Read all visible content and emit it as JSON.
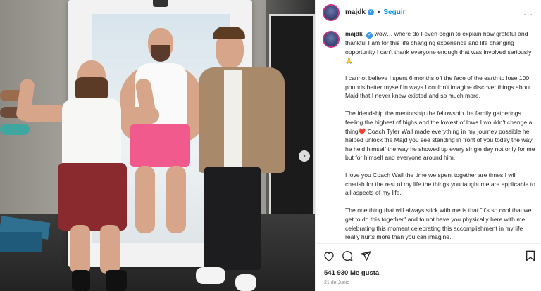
{
  "post": {
    "username": "majdk",
    "follow_label": "Seguir",
    "dot_separator": "•",
    "more_label": "...",
    "caption_username": "majdk",
    "caption_paragraphs": [
      "wow… where do I even begin to explain how grateful and thankful I am for this life changing experience and life changing opportunity I can't thank everyone enough that was involved seriously🙏",
      "I cannot believe I spent 6 months off the face of the earth to lose 100 pounds better myself in ways I couldn't imagine discover things about Majd that I never knew existed and so much more.",
      "The friendship the mentorship the fellowship the family gatherings feeling the highest of highs and the lowest of lows I wouldn't change a thing❤️ Coach Tyler Wall made everything in my journey possible he helped unlock the Majd you see standing in front of you today the way he held himself the way he showed up every single day not only for me but for himself and everyone around him.",
      "I love you Coach Wall the time we spent together are times I will cherish for the rest of my life the things you taught me are applicable to all aspects of my life.",
      "The one thing that will always stick with me is that \"it's so cool that we get to do this together\" and to not have you physically here with me celebrating this moment celebrating this accomplishment in my life really hurts more than you can imagine."
    ],
    "likes": "541 930 Me gusta",
    "date": "21 de Junio"
  },
  "icons": {
    "like": "heart-icon",
    "comment": "comment-icon",
    "share": "send-icon",
    "save": "bookmark-icon",
    "next": "chevron-right-icon"
  },
  "colors": {
    "link": "#0095f6",
    "verified": "#3897f0",
    "text": "#262626",
    "muted": "#8e8e8e"
  }
}
